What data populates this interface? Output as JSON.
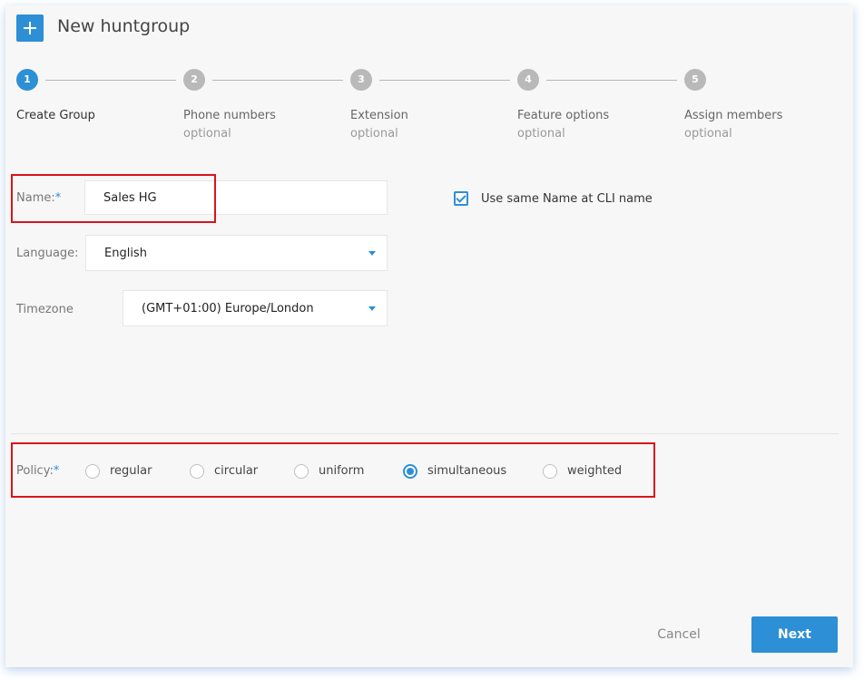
{
  "header": {
    "title": "New huntgroup",
    "icon": "plus-icon"
  },
  "steps": [
    {
      "number": "1",
      "title": "Create Group",
      "subtitle": ""
    },
    {
      "number": "2",
      "title": "Phone numbers",
      "subtitle": "optional"
    },
    {
      "number": "3",
      "title": "Extension",
      "subtitle": "optional"
    },
    {
      "number": "4",
      "title": "Feature options",
      "subtitle": "optional"
    },
    {
      "number": "5",
      "title": "Assign members",
      "subtitle": "optional"
    }
  ],
  "form": {
    "name": {
      "label": "Name:",
      "required": "*",
      "value": "Sales HG"
    },
    "cli_checkbox": {
      "label": "Use same Name at CLI name",
      "checked": true
    },
    "language": {
      "label": "Language:",
      "value": "English"
    },
    "timezone": {
      "label": "Timezone",
      "value": "(GMT+01:00) Europe/London"
    },
    "policy": {
      "label": "Policy:",
      "required": "*",
      "options": [
        "regular",
        "circular",
        "uniform",
        "simultaneous",
        "weighted"
      ],
      "selected": "simultaneous"
    }
  },
  "buttons": {
    "cancel": "Cancel",
    "next": "Next"
  },
  "colors": {
    "accent": "#2d8fd5",
    "highlight": "#d9141b",
    "inactive_step": "#b9b9b9"
  }
}
